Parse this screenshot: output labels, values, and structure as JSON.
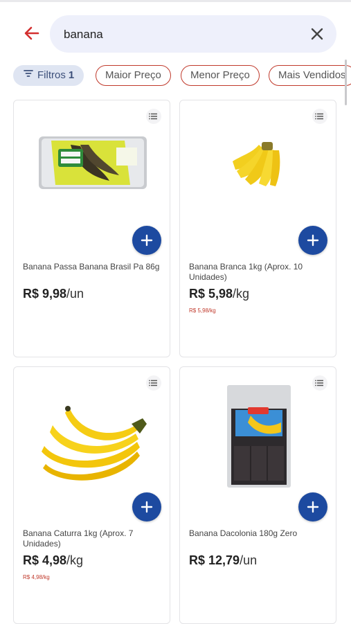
{
  "search": {
    "query": "banana"
  },
  "filters": {
    "filter_chip": {
      "label": "Filtros",
      "count": "1"
    },
    "sort_chips": [
      "Maior Preço",
      "Menor Preço",
      "Mais Vendidos"
    ]
  },
  "products": [
    {
      "name": "Banana Passa Banana Brasil Pa 86g",
      "price": "R$ 9,98",
      "unit": "/un",
      "old_price": ""
    },
    {
      "name": "Banana Branca 1kg (Aprox. 10 Unidades)",
      "price": "R$ 5,98",
      "unit": "/kg",
      "old_price": "R$ 5,98/kg"
    },
    {
      "name": "Banana Caturra 1kg (Aprox. 7 Unidades)",
      "price": "R$ 4,98",
      "unit": "/kg",
      "old_price": "R$ 4,98/kg"
    },
    {
      "name": "Banana Dacolonia 180g Zero",
      "price": "R$ 12,79",
      "unit": "/un",
      "old_price": ""
    }
  ],
  "colors": {
    "accent": "#1d4aa0",
    "back_arrow": "#d32f2f",
    "chip_border": "#c0392b",
    "search_bg": "#eef0fb"
  },
  "icons": {
    "back": "arrow-left-icon",
    "clear": "close-icon",
    "filter": "filter-lines-icon",
    "add": "plus-icon",
    "menu": "list-icon"
  }
}
